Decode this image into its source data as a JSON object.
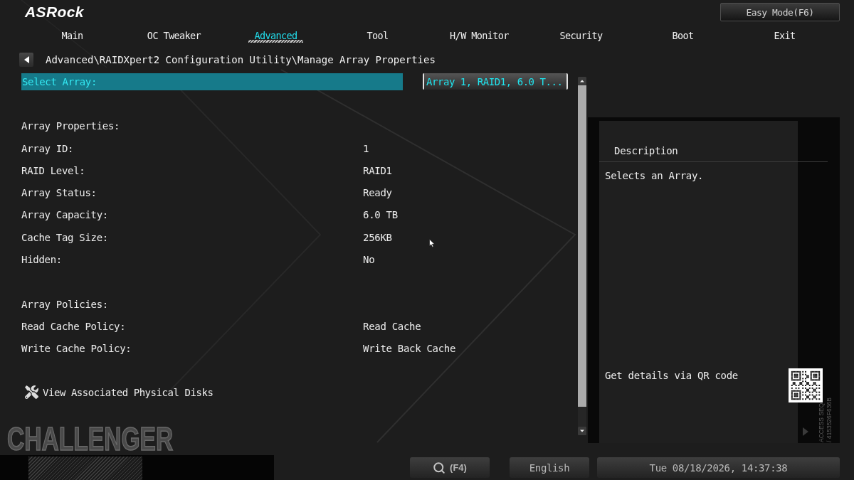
{
  "header": {
    "logo": "ASRock",
    "mode_button": "Easy Mode(F6)"
  },
  "tabs": [
    {
      "label": "Main",
      "selected": false
    },
    {
      "label": "OC Tweaker",
      "selected": false
    },
    {
      "label": "Advanced",
      "selected": true
    },
    {
      "label": "Tool",
      "selected": false
    },
    {
      "label": "H/W Monitor",
      "selected": false
    },
    {
      "label": "Security",
      "selected": false
    },
    {
      "label": "Boot",
      "selected": false
    },
    {
      "label": "Exit",
      "selected": false
    }
  ],
  "breadcrumb": "Advanced\\RAIDXpert2 Configuration Utility\\Manage Array Properties",
  "settings": [
    {
      "kind": "select",
      "label": "Select Array:",
      "value": "Array 1, RAID1, 6.0 T...",
      "selected": true
    },
    {
      "kind": "heading",
      "label": "Array Properties:"
    },
    {
      "kind": "info",
      "label": "Array ID:",
      "value": "1"
    },
    {
      "kind": "info",
      "label": "RAID Level:",
      "value": "RAID1"
    },
    {
      "kind": "info",
      "label": "Array Status:",
      "value": "Ready"
    },
    {
      "kind": "info",
      "label": "Array Capacity:",
      "value": "6.0 TB"
    },
    {
      "kind": "info",
      "label": "Cache Tag Size:",
      "value": "256KB"
    },
    {
      "kind": "info",
      "label": "Hidden:",
      "value": "No"
    },
    {
      "kind": "heading",
      "label": "Array Policies:"
    },
    {
      "kind": "info",
      "label": "Read Cache Policy:",
      "value": "Read Cache"
    },
    {
      "kind": "info",
      "label": "Write Cache Policy:",
      "value": "Write Back Cache"
    },
    {
      "kind": "submenu",
      "label": "View Associated Physical Disks",
      "selected": false
    }
  ],
  "description": {
    "title": "Description",
    "text": "Selects an Array.",
    "qr_caption": "Get details via QR code",
    "access_code": [
      "ACCESS SEQ",
      "/ 4153526F636B"
    ]
  },
  "branding": "CHALLENGER",
  "footer": {
    "search_key": "(F4)",
    "language": "English",
    "datetime": "Tue 08/18/2026, 14:37:38"
  }
}
